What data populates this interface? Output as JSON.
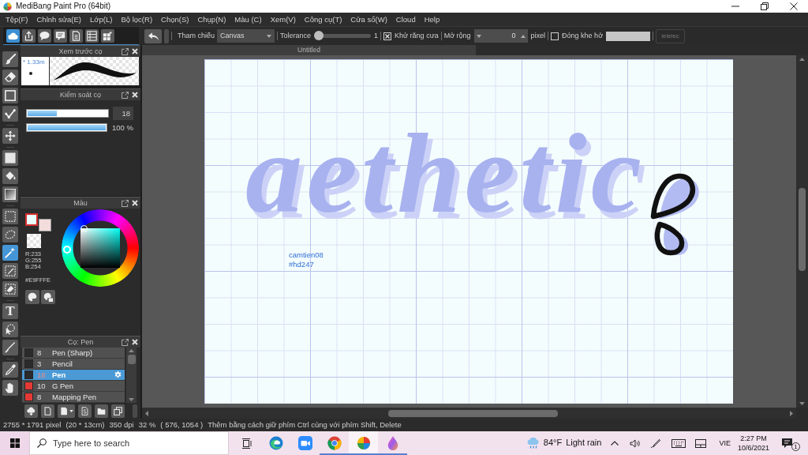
{
  "window": {
    "title": "MediBang Paint Pro (64bit)"
  },
  "menu": [
    "Tệp(F)",
    "Chỉnh sửa(E)",
    "Lớp(L)",
    "Bộ lọc(R)",
    "Chọn(S)",
    "Chụp(N)",
    "Màu (C)",
    "Xem(V)",
    "Công cụ(T)",
    "Cửa sổ(W)",
    "Cloud",
    "Help"
  ],
  "quick_tools": [
    {
      "kind": "cloud",
      "selected": true
    },
    {
      "kind": "share",
      "selected": false
    },
    {
      "kind": "chat",
      "selected": false
    },
    {
      "kind": "comment",
      "selected": false
    },
    {
      "kind": "document",
      "selected": false
    },
    {
      "kind": "list",
      "selected": false
    },
    {
      "kind": "grid",
      "selected": false
    }
  ],
  "tool_options": {
    "reference_label": "Tham chiếu",
    "reference_value": "Canvas",
    "tolerance_label": "Tolerance",
    "tolerance": {
      "level": 0
    },
    "tolerance_value": "1",
    "antialias": {
      "label": "Khử răng cưa",
      "checked": true
    },
    "expand_label": "Mở rộng",
    "expand_value": "0",
    "expand_unit": "pixel",
    "close_gap": {
      "label": "Đóng khe hở",
      "checked": false
    },
    "action_button": {
      "label": "ielelec",
      "disabled": true
    }
  },
  "tool_groups": [
    {
      "tools": [
        {
          "kind": "brush",
          "selected": false
        },
        {
          "kind": "eraser",
          "selected": false
        },
        {
          "kind": "shape",
          "selected": false
        },
        {
          "kind": "polyline",
          "selected": false
        }
      ]
    },
    {
      "tools": [
        {
          "kind": "move",
          "selected": false
        }
      ]
    },
    {
      "tools": [
        {
          "kind": "fill",
          "selected": false
        },
        {
          "kind": "bucket",
          "selected": false
        },
        {
          "kind": "gradient",
          "selected": false
        }
      ]
    },
    {
      "tools": [
        {
          "kind": "select",
          "selected": false
        },
        {
          "kind": "lasso",
          "selected": false
        },
        {
          "kind": "wand",
          "selected": true
        },
        {
          "kind": "select-pen",
          "selected": false
        },
        {
          "kind": "select-eraser",
          "selected": false
        }
      ]
    },
    {
      "tools": [
        {
          "kind": "text",
          "label": "T",
          "selected": false
        },
        {
          "kind": "operation",
          "selected": false
        },
        {
          "kind": "divide",
          "selected": false
        }
      ]
    },
    {
      "tools": [
        {
          "kind": "eyedropper",
          "selected": false
        },
        {
          "kind": "hand",
          "selected": false
        }
      ]
    }
  ],
  "brush_preview": {
    "title": "Xem trước cọ",
    "size_text": "* 1.33m"
  },
  "brush_control": {
    "title": "Kiểm soát cọ",
    "size": {
      "level": 0.37
    },
    "size_value": "18",
    "opacity": {
      "level": 1
    },
    "opacity_value": "100 %"
  },
  "color_panel": {
    "title": "Màu",
    "swatches": [
      {
        "color": "#e9fffe",
        "selected": true
      },
      {
        "color": "#f3dcdc",
        "selected": false
      }
    ],
    "rgb": [
      "R:233",
      "G:255",
      "B:254"
    ],
    "hex": "#E9FFFE"
  },
  "brush_list": {
    "title": "Cọ: Pen",
    "brushes": [
      {
        "color": "#2b2b2b",
        "size": "8",
        "name": "Pen (Sharp)",
        "selected": false
      },
      {
        "color": "#2b2b2b",
        "size": "3",
        "name": "Pencil",
        "selected": false
      },
      {
        "color": "#2b2b2b",
        "size": "18",
        "name": "Pen",
        "selected": true
      },
      {
        "color": "#e53935",
        "size": "10",
        "name": "G Pen",
        "selected": false
      },
      {
        "color": "#e53935",
        "size": "8",
        "name": "Mapping Pen",
        "selected": false
      }
    ]
  },
  "document": {
    "tab": "Untitled",
    "lettering": "aethetic",
    "notes": [
      "camtien08",
      "#hd247"
    ]
  },
  "status_bar": [
    "2755 * 1791 pixel",
    "(20 * 13cm)",
    "350 dpi",
    "32 %",
    "( 576, 1054 )",
    "Thêm bằng cách giữ phím Ctrl cùng với phím Shift, Delete"
  ],
  "taskbar": {
    "search_placeholder": "Type here to search",
    "apps": [
      {
        "kind": "edge",
        "running": false,
        "selected": false
      },
      {
        "kind": "zoom",
        "running": false,
        "selected": false
      },
      {
        "kind": "chrome",
        "running": true,
        "selected": false
      },
      {
        "kind": "medibang",
        "running": true,
        "selected": true
      },
      {
        "kind": "drop",
        "running": true,
        "selected": false
      }
    ],
    "temperature": "84°F",
    "weather": "Light rain",
    "language": "VIE",
    "time": "2:27 PM",
    "date": "10/6/2021",
    "notification_count": "1"
  }
}
